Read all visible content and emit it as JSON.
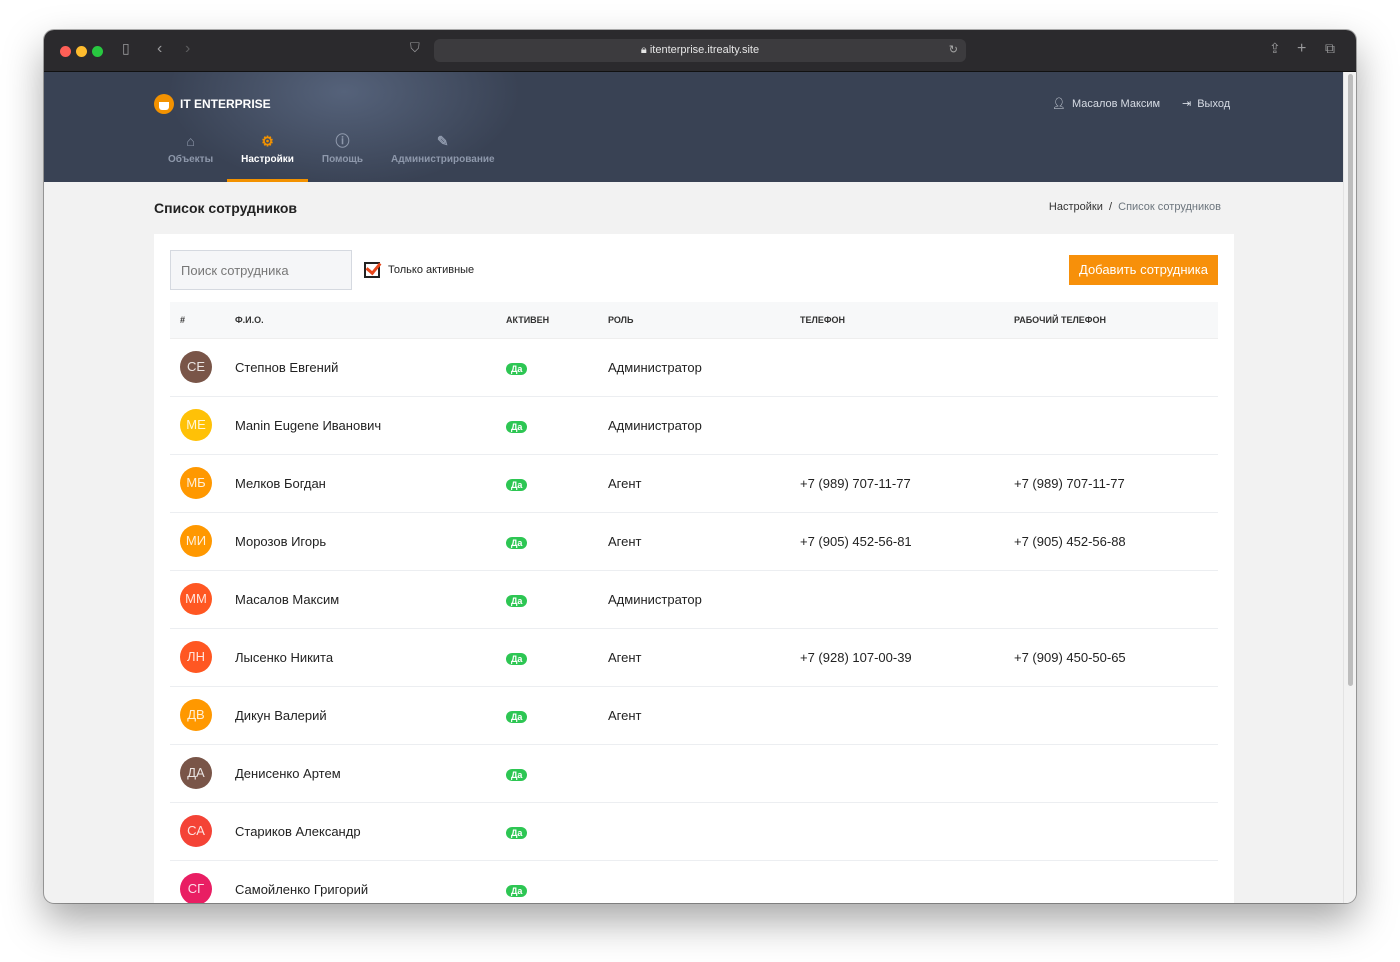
{
  "browser": {
    "url": "itenterprise.itrealty.site"
  },
  "header": {
    "logo": "IT ENTERPRISE",
    "user": "Масалов Максим",
    "logout": "Выход",
    "nav": [
      {
        "label": "Объекты",
        "icon": "home-icon"
      },
      {
        "label": "Настройки",
        "icon": "gear-icon",
        "active": true
      },
      {
        "label": "Помощь",
        "icon": "info-icon"
      },
      {
        "label": "Администрирование",
        "icon": "pencil-icon"
      }
    ]
  },
  "page": {
    "title": "Список сотрудников",
    "breadcrumb": [
      "Настройки",
      "Список сотрудников"
    ]
  },
  "toolbar": {
    "search_placeholder": "Поиск сотрудника",
    "only_active": "Только активные",
    "add_button": "Добавить сотрудника"
  },
  "table": {
    "headers": [
      "#",
      "Ф.И.О.",
      "АКТИВЕН",
      "РОЛЬ",
      "ТЕЛЕФОН",
      "РАБОЧИЙ ТЕЛЕФОН"
    ],
    "rows": [
      {
        "initials": "СЕ",
        "color": "#795548",
        "name": "Степнов Евгений",
        "active": "Да",
        "role": "Администратор",
        "phone": "",
        "work_phone": ""
      },
      {
        "initials": "ME",
        "color": "#ffc107",
        "name": "Manin Eugene Иванович",
        "active": "Да",
        "role": "Администратор",
        "phone": "",
        "work_phone": ""
      },
      {
        "initials": "МБ",
        "color": "#ff9800",
        "name": "Мелков Богдан",
        "active": "Да",
        "role": "Агент",
        "phone": "+7 (989) 707-11-77",
        "work_phone": "+7 (989) 707-11-77"
      },
      {
        "initials": "МИ",
        "color": "#ff9800",
        "name": "Морозов Игорь",
        "active": "Да",
        "role": "Агент",
        "phone": "+7 (905) 452-56-81",
        "work_phone": "+7 (905) 452-56-88"
      },
      {
        "initials": "ММ",
        "color": "#ff5722",
        "name": "Масалов Максим",
        "active": "Да",
        "role": "Администратор",
        "phone": "",
        "work_phone": ""
      },
      {
        "initials": "ЛН",
        "color": "#ff5722",
        "name": "Лысенко Никита",
        "active": "Да",
        "role": "Агент",
        "phone": "+7 (928) 107-00-39",
        "work_phone": "+7 (909) 450-50-65"
      },
      {
        "initials": "ДВ",
        "color": "#ff9800",
        "name": "Дикун Валерий",
        "active": "Да",
        "role": "Агент",
        "phone": "",
        "work_phone": ""
      },
      {
        "initials": "ДА",
        "color": "#795548",
        "name": "Денисенко Артем",
        "active": "Да",
        "role": "",
        "phone": "",
        "work_phone": ""
      },
      {
        "initials": "СА",
        "color": "#f44336",
        "name": "Стариков Александр",
        "active": "Да",
        "role": "",
        "phone": "",
        "work_phone": ""
      },
      {
        "initials": "СГ",
        "color": "#e91e63",
        "name": "Самойленко Григорий",
        "active": "Да",
        "role": "",
        "phone": "",
        "work_phone": ""
      }
    ]
  }
}
